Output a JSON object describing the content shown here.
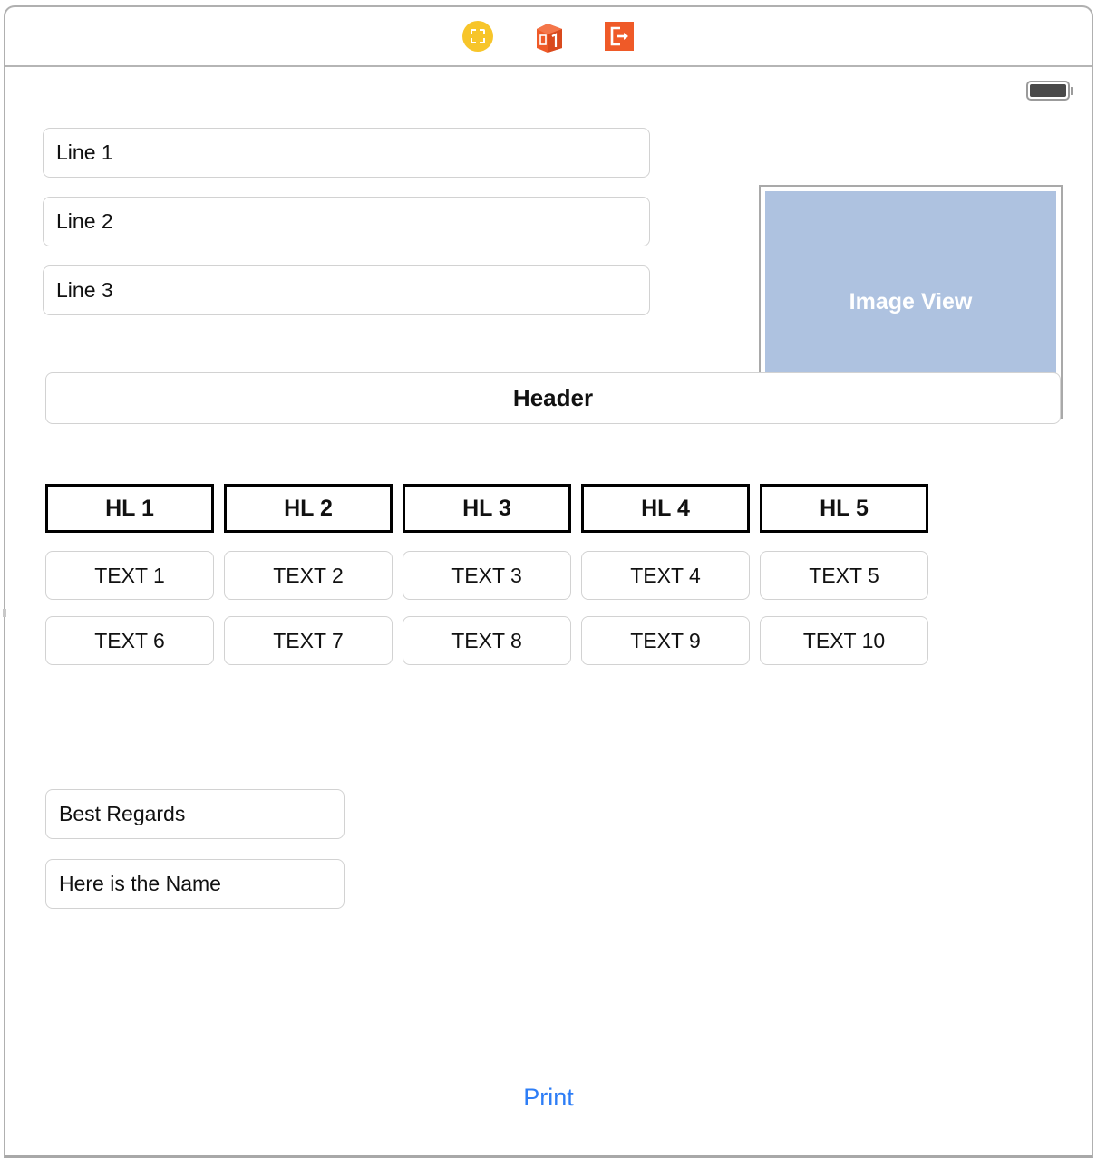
{
  "toolbar": {
    "icons": [
      {
        "name": "marquee-select-icon",
        "color": "#f7c52a"
      },
      {
        "name": "box-1-icon",
        "color": "#ef5a28"
      },
      {
        "name": "export-icon",
        "color": "#ef5a28"
      }
    ]
  },
  "status": {
    "battery_name": "battery-icon",
    "battery_color": "#4a4a4a"
  },
  "lines": [
    {
      "value": "Line 1"
    },
    {
      "value": "Line 2"
    },
    {
      "value": "Line 3"
    }
  ],
  "image_view": {
    "label": "Image View",
    "fill_color": "#aec2e0"
  },
  "header": {
    "label": "Header"
  },
  "grid": {
    "headline_row": [
      "HL 1",
      "HL 2",
      "HL 3",
      "HL 4",
      "HL 5"
    ],
    "text_row_1": [
      "TEXT 1",
      "TEXT 2",
      "TEXT 3",
      "TEXT 4",
      "TEXT 5"
    ],
    "text_row_2": [
      "TEXT 6",
      "TEXT 7",
      "TEXT 8",
      "TEXT 9",
      "TEXT 10"
    ]
  },
  "signature": [
    {
      "value": "Best Regards"
    },
    {
      "value": "Here is the Name"
    }
  ],
  "footer": {
    "print_label": "Print",
    "print_color": "#2d7df6"
  }
}
